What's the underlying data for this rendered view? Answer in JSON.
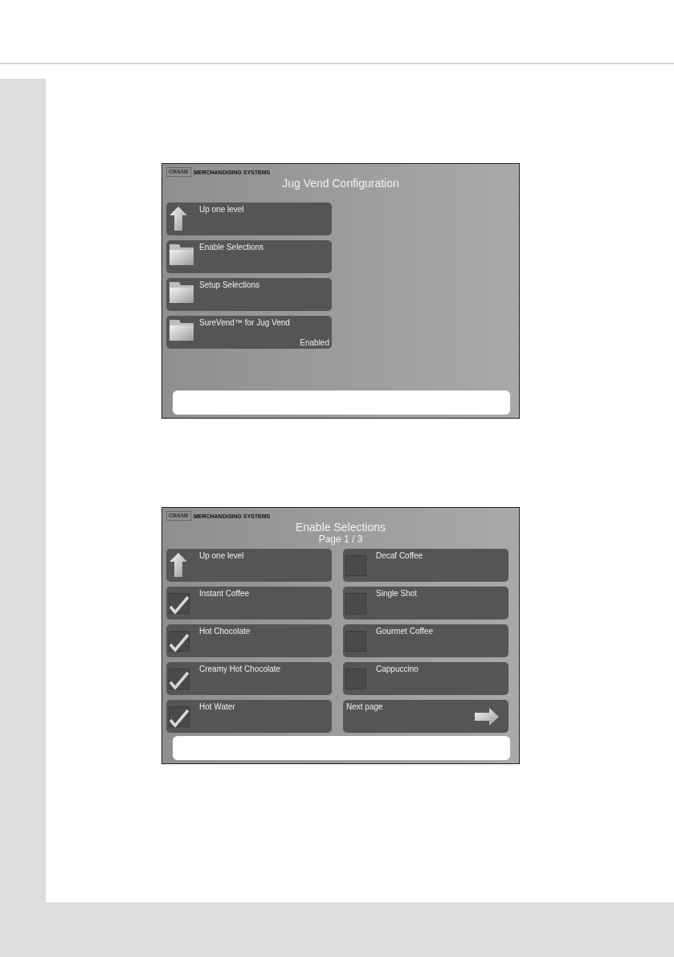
{
  "screens": [
    {
      "logo": {
        "brand": "CRANE",
        "text": "MERCHANDISING SYSTEMS"
      },
      "title": "Jug Vend Configuration",
      "columns": [
        [
          {
            "kind": "up",
            "label": "Up one level"
          },
          {
            "kind": "folder",
            "label": "Enable Selections"
          },
          {
            "kind": "folder",
            "label": "Setup Selections"
          },
          {
            "kind": "folder",
            "label": "SureVend™ for Jug Vend",
            "value": "Enabled"
          }
        ]
      ]
    },
    {
      "logo": {
        "brand": "CRANE",
        "text": "MERCHANDISING SYSTEMS"
      },
      "title": "Enable Selections",
      "subtitle": "Page 1 / 3",
      "columns": [
        [
          {
            "kind": "up",
            "label": "Up one level"
          },
          {
            "kind": "check",
            "label": "Instant Coffee",
            "checked": true
          },
          {
            "kind": "check",
            "label": "Hot Chocolate",
            "checked": true
          },
          {
            "kind": "check",
            "label": "Creamy Hot Chocolate",
            "checked": true
          },
          {
            "kind": "check",
            "label": "Hot Water",
            "checked": true
          }
        ],
        [
          {
            "kind": "check",
            "label": "Decaf Coffee",
            "checked": false
          },
          {
            "kind": "check",
            "label": "Single Shot",
            "checked": false
          },
          {
            "kind": "check",
            "label": "Gourmet Coffee",
            "checked": false
          },
          {
            "kind": "check",
            "label": "Cappuccino",
            "checked": false
          },
          {
            "kind": "next",
            "label": "Next page"
          }
        ]
      ]
    }
  ]
}
